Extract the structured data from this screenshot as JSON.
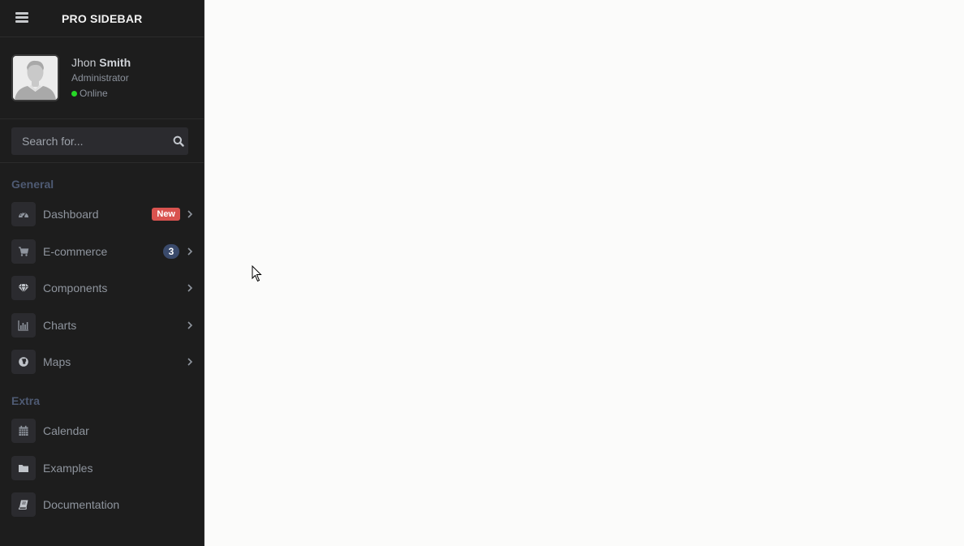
{
  "brand": {
    "title": "PRO SIDEBAR",
    "menu_icon": "hamburger-icon"
  },
  "user": {
    "first_name": "Jhon",
    "last_name": "Smith",
    "role": "Administrator",
    "status": "Online",
    "status_color": "#26d826"
  },
  "search": {
    "placeholder": "Search for...",
    "value": "",
    "icon": "search-icon"
  },
  "sections": [
    {
      "header": "General",
      "items": [
        {
          "label": "Dashboard",
          "icon": "tachometer-icon",
          "badge": "New",
          "badge_type": "new",
          "badge_color": "#d9534f",
          "has_submenu": true
        },
        {
          "label": "E-commerce",
          "icon": "shopping-cart-icon",
          "badge": "3",
          "badge_type": "count",
          "badge_color": "#3a4a6b",
          "has_submenu": true
        },
        {
          "label": "Components",
          "icon": "diamond-icon",
          "badge": "",
          "has_submenu": true
        },
        {
          "label": "Charts",
          "icon": "bar-chart-icon",
          "badge": "",
          "has_submenu": true
        },
        {
          "label": "Maps",
          "icon": "globe-icon",
          "badge": "",
          "has_submenu": true
        }
      ]
    },
    {
      "header": "Extra",
      "items": [
        {
          "label": "Calendar",
          "icon": "calendar-icon",
          "badge": "",
          "has_submenu": false
        },
        {
          "label": "Examples",
          "icon": "folder-icon",
          "badge": "",
          "has_submenu": false
        },
        {
          "label": "Documentation",
          "icon": "book-icon",
          "badge": "",
          "has_submenu": false
        }
      ]
    }
  ],
  "colors": {
    "sidebar_bg": "#1d1d1d",
    "content_bg": "#fbfbfa",
    "section_header": "#4e5a73",
    "menu_text": "#8f959e",
    "icon_bg": "#2b2b2f"
  }
}
